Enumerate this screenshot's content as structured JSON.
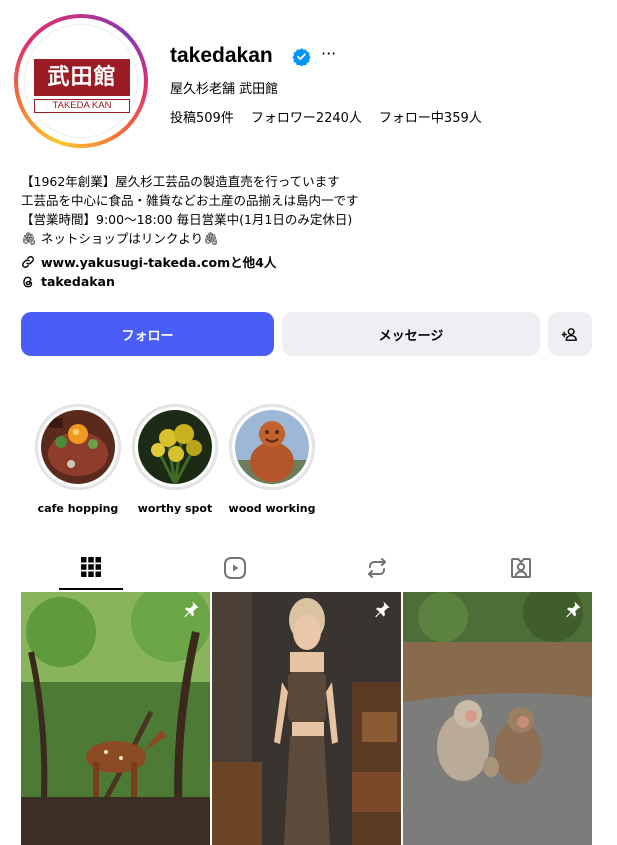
{
  "profile": {
    "logo_text": "武田館",
    "logo_sub": "TAKEDA KAN",
    "username": "takedakan",
    "more": "···",
    "full_name": "屋久杉老舗 武田館",
    "stats": {
      "posts": "投稿509件",
      "followers": "フォロワー2240人",
      "following": "フォロー中359人"
    }
  },
  "bio": {
    "lines": [
      "【1962年創業】屋久杉工芸品の製造直売を行っています",
      "工芸品を中心に食品・雑貨などお土産の品揃えは島内一です",
      "【営業時間】9:00〜18:00 毎日営業中(1月1日のみ定休日)",
      "🖇 ネットショップはリンクより🖇"
    ],
    "link": "www.yakusugi-takeda.comと他4人",
    "threads": "takedakan"
  },
  "actions": {
    "follow": "フォロー",
    "message": "メッセージ",
    "add_icon": "add-person-icon"
  },
  "highlights": [
    {
      "label": "cafe hopping"
    },
    {
      "label": "worthy spot"
    },
    {
      "label": "wood working"
    }
  ],
  "tabs": [
    {
      "icon": "grid-icon",
      "active": true
    },
    {
      "icon": "reels-icon",
      "active": false
    },
    {
      "icon": "repost-icon",
      "active": false
    },
    {
      "icon": "tagged-icon",
      "active": false
    }
  ],
  "colors": {
    "accent": "#4a5df9",
    "secondary_button": "#efeff3",
    "verified": "#0095f6",
    "logo": "#9b1c24"
  }
}
